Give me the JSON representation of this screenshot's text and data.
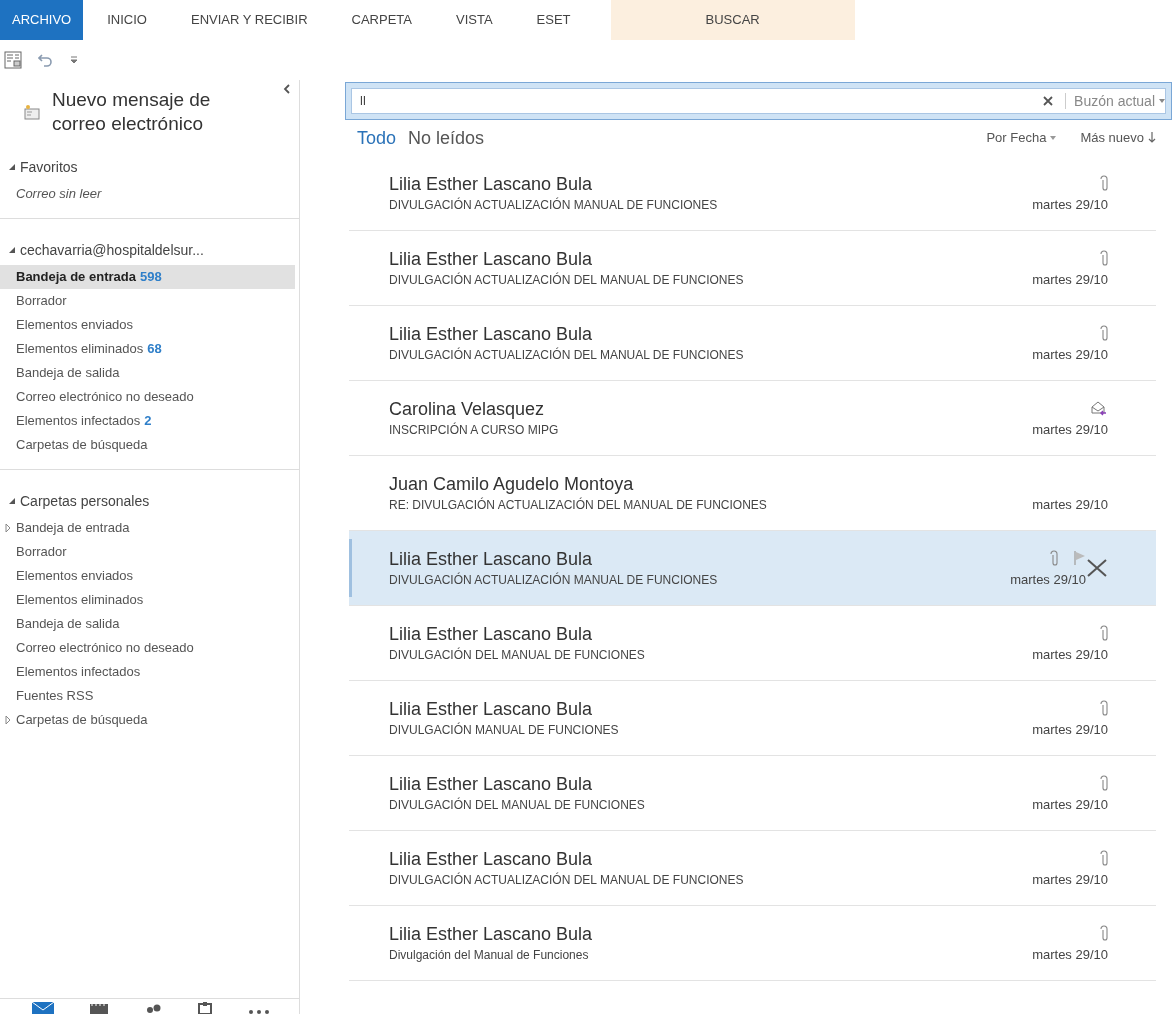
{
  "ribbon_tabs": [
    {
      "label": "ARCHIVO",
      "selected": true,
      "highlighted": false
    },
    {
      "label": "INICIO",
      "selected": false,
      "highlighted": false
    },
    {
      "label": "ENVIAR Y RECIBIR",
      "selected": false,
      "highlighted": false
    },
    {
      "label": "CARPETA",
      "selected": false,
      "highlighted": false
    },
    {
      "label": "VISTA",
      "selected": false,
      "highlighted": false
    },
    {
      "label": "ESET",
      "selected": false,
      "highlighted": false
    },
    {
      "label": "BUSCAR",
      "selected": false,
      "highlighted": true
    }
  ],
  "new_message": {
    "label": "Nuevo mensaje de correo electrónico"
  },
  "folder_groups": [
    {
      "label": "Favoritos",
      "expanded": true,
      "items": [
        {
          "label": "Correo sin leer",
          "italic": true,
          "selected": false
        }
      ]
    },
    {
      "label": "cechavarria@hospitaldelsur...",
      "expanded": true,
      "items": [
        {
          "label": "Bandeja de entrada",
          "count": "598",
          "selected": true
        },
        {
          "label": "Borrador",
          "selected": false
        },
        {
          "label": "Elementos enviados",
          "selected": false
        },
        {
          "label": "Elementos eliminados",
          "count": "68",
          "selected": false
        },
        {
          "label": "Bandeja de salida",
          "selected": false
        },
        {
          "label": "Correo electrónico no deseado",
          "selected": false
        },
        {
          "label": "Elementos infectados",
          "count": "2",
          "selected": false
        },
        {
          "label": "Carpetas de búsqueda",
          "selected": false
        }
      ]
    },
    {
      "label": "Carpetas personales",
      "expanded": true,
      "items": [
        {
          "label": "Bandeja de entrada",
          "selected": false,
          "expandable": true
        },
        {
          "label": "Borrador",
          "selected": false
        },
        {
          "label": "Elementos enviados",
          "selected": false
        },
        {
          "label": "Elementos eliminados",
          "selected": false
        },
        {
          "label": "Bandeja de salida",
          "selected": false
        },
        {
          "label": "Correo electrónico no deseado",
          "selected": false
        },
        {
          "label": "Elementos infectados",
          "selected": false
        },
        {
          "label": "Fuentes RSS",
          "selected": false
        },
        {
          "label": "Carpetas de búsqueda",
          "selected": false,
          "expandable": true
        }
      ]
    }
  ],
  "nav_bar": [
    {
      "kind": "mail",
      "selected": true
    },
    {
      "kind": "calendar",
      "selected": false
    },
    {
      "kind": "people",
      "selected": false
    },
    {
      "kind": "tasks",
      "selected": false
    },
    {
      "kind": "more",
      "selected": false
    }
  ],
  "search": {
    "value": "ll",
    "scope": "Buzón actual"
  },
  "filters": [
    {
      "label": "Todo",
      "selected": true
    },
    {
      "label": "No leídos",
      "selected": false
    }
  ],
  "sort": {
    "by": "Por Fecha",
    "order": "Más nuevo"
  },
  "messages": [
    {
      "sender": "Lilia Esther Lascano Bula",
      "subject": "DIVULGACIÓN ACTUALIZACIÓN MANUAL DE FUNCIONES",
      "date": "martes 29/10",
      "kind": "attachment",
      "selected": false
    },
    {
      "sender": "Lilia Esther Lascano Bula",
      "subject": "DIVULGACIÓN ACTUALIZACIÓN DEL MANUAL DE FUNCIONES",
      "date": "martes 29/10",
      "kind": "attachment",
      "selected": false
    },
    {
      "sender": "Lilia Esther Lascano Bula",
      "subject": "DIVULGACIÓN ACTUALIZACIÓN DEL MANUAL DE FUNCIONES",
      "date": "martes 29/10",
      "kind": "attachment",
      "selected": false
    },
    {
      "sender": "Carolina Velasquez",
      "subject": "INSCRIPCIÓN A CURSO MIPG",
      "date": "martes 29/10",
      "kind": "forwarded",
      "selected": false
    },
    {
      "sender": "Juan Camilo Agudelo Montoya",
      "subject": "RE: DIVULGACIÓN ACTUALIZACIÓN DEL MANUAL DE FUNCIONES",
      "date": "martes 29/10",
      "kind": "plain",
      "selected": false
    },
    {
      "sender": "Lilia Esther Lascano Bula",
      "subject": "DIVULGACIÓN ACTUALIZACIÓN MANUAL DE FUNCIONES",
      "date": "martes 29/10",
      "kind": "attachment",
      "selected": true
    },
    {
      "sender": "Lilia Esther Lascano Bula",
      "subject": "DIVULGACIÓN DEL MANUAL DE FUNCIONES",
      "date": "martes 29/10",
      "kind": "attachment",
      "selected": false
    },
    {
      "sender": "Lilia Esther Lascano Bula",
      "subject": "DIVULGACIÓN MANUAL DE FUNCIONES",
      "date": "martes 29/10",
      "kind": "attachment",
      "selected": false
    },
    {
      "sender": "Lilia Esther Lascano Bula",
      "subject": "DIVULGACIÓN DEL MANUAL DE FUNCIONES",
      "date": "martes 29/10",
      "kind": "attachment",
      "selected": false
    },
    {
      "sender": "Lilia Esther Lascano Bula",
      "subject": "DIVULGACIÓN ACTUALIZACIÓN DEL MANUAL DE FUNCIONES",
      "date": "martes 29/10",
      "kind": "attachment",
      "selected": false
    },
    {
      "sender": "Lilia Esther Lascano Bula",
      "subject": "Divulgación del Manual de Funciones",
      "date": "martes 29/10",
      "kind": "attachment",
      "selected": false
    }
  ]
}
